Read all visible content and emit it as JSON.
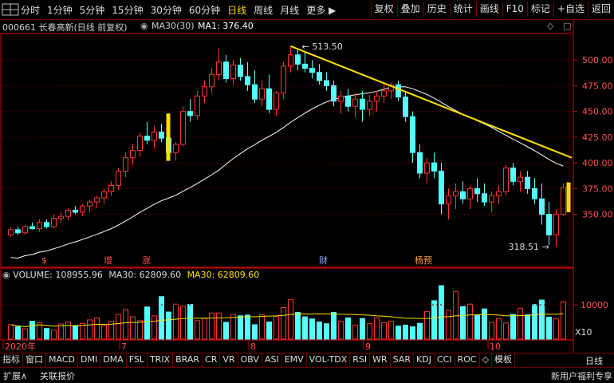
{
  "toolbar": {
    "periods": [
      "分时",
      "1分钟",
      "5分钟",
      "15分钟",
      "30分钟",
      "60分钟",
      "日线",
      "周线",
      "月线",
      "更多"
    ],
    "active_period": "日线",
    "more_arrow": "▶",
    "buttons": [
      "复权",
      "叠加",
      "历史",
      "统计",
      "画线",
      "F10",
      "标记",
      "+自选",
      "返回"
    ]
  },
  "info": {
    "stock": "000661 长春高新(日线 前复权)",
    "ma30_label": "MA30(30)",
    "ma1_label": "MA1: 376.40"
  },
  "volume_info": {
    "volume": "VOLUME: 108955.96",
    "ma30_white": "MA30: 62809.60",
    "ma30_yellow": "MA30: 62809.60",
    "multiplier": "X10"
  },
  "annotations": {
    "high": "513.50",
    "low": "318.51",
    "markers": [
      "$",
      "增",
      "涨",
      "财",
      "杨预"
    ]
  },
  "tabs": [
    "指标",
    "窗口",
    "MACD",
    "DMI",
    "DMA",
    "FSL",
    "TRIX",
    "BRAR",
    "CR",
    "VR",
    "OBV",
    "ASI",
    "EMV",
    "VOL-TDX",
    "RSI",
    "WR",
    "SAR",
    "KDJ",
    "CCI",
    "ROC",
    "◇",
    "模板"
  ],
  "tab_right": "日线",
  "bottom": {
    "expand": "扩展∧",
    "related": "关联报价",
    "promo": "新用户福利专享"
  },
  "colors": {
    "up": "#ff3232",
    "down": "#54ffff",
    "trend": "#ffe000",
    "ma": "#ffffff",
    "axis": "#d00000"
  },
  "chart_data": {
    "type": "candlestick",
    "y_ticks": [
      500.0,
      475.0,
      450.0,
      425.0,
      400.0,
      375.0,
      350.0
    ],
    "volume_ticks": [
      10000
    ],
    "x_labels": [
      "2020年",
      "7",
      "8",
      "9",
      "10"
    ],
    "ylim": [
      300,
      525
    ],
    "series": [
      {
        "name": "MA30",
        "values": []
      }
    ],
    "candles": [
      [
        330,
        337,
        328,
        335
      ],
      [
        335,
        338,
        330,
        332
      ],
      [
        332,
        340,
        330,
        338
      ],
      [
        338,
        342,
        335,
        336
      ],
      [
        336,
        345,
        333,
        342
      ],
      [
        342,
        345,
        336,
        338
      ],
      [
        338,
        350,
        336,
        346
      ],
      [
        346,
        352,
        342,
        348
      ],
      [
        348,
        356,
        344,
        354
      ],
      [
        354,
        358,
        350,
        352
      ],
      [
        352,
        360,
        348,
        358
      ],
      [
        358,
        364,
        352,
        362
      ],
      [
        362,
        368,
        356,
        366
      ],
      [
        366,
        375,
        360,
        372
      ],
      [
        372,
        382,
        368,
        378
      ],
      [
        378,
        395,
        374,
        392
      ],
      [
        392,
        410,
        386,
        405
      ],
      [
        405,
        418,
        398,
        412
      ],
      [
        412,
        430,
        406,
        426
      ],
      [
        426,
        440,
        418,
        422
      ],
      [
        422,
        436,
        414,
        430
      ],
      [
        430,
        438,
        420,
        424
      ],
      [
        424,
        432,
        405,
        410
      ],
      [
        410,
        420,
        402,
        418
      ],
      [
        418,
        455,
        416,
        450
      ],
      [
        450,
        462,
        440,
        446
      ],
      [
        446,
        470,
        442,
        465
      ],
      [
        465,
        480,
        458,
        474
      ],
      [
        474,
        492,
        468,
        486
      ],
      [
        486,
        512,
        480,
        498
      ],
      [
        498,
        505,
        478,
        482
      ],
      [
        482,
        500,
        476,
        495
      ],
      [
        495,
        502,
        480,
        484
      ],
      [
        484,
        498,
        470,
        476
      ],
      [
        476,
        490,
        458,
        462
      ],
      [
        462,
        480,
        455,
        472
      ],
      [
        472,
        486,
        448,
        452
      ],
      [
        452,
        470,
        446,
        468
      ],
      [
        468,
        498,
        462,
        494
      ],
      [
        494,
        513.5,
        488,
        505
      ],
      [
        505,
        510,
        490,
        496
      ],
      [
        496,
        508,
        488,
        492
      ],
      [
        492,
        500,
        482,
        488
      ],
      [
        488,
        496,
        476,
        480
      ],
      [
        480,
        488,
        470,
        475
      ],
      [
        475,
        480,
        455,
        460
      ],
      [
        460,
        470,
        448,
        465
      ],
      [
        465,
        472,
        450,
        455
      ],
      [
        455,
        468,
        444,
        462
      ],
      [
        462,
        470,
        440,
        452
      ],
      [
        452,
        466,
        446,
        460
      ],
      [
        460,
        470,
        450,
        465
      ],
      [
        465,
        478,
        458,
        470
      ],
      [
        470,
        478,
        462,
        476
      ],
      [
        476,
        480,
        460,
        464
      ],
      [
        464,
        470,
        440,
        445
      ],
      [
        445,
        450,
        400,
        410
      ],
      [
        410,
        418,
        385,
        390
      ],
      [
        390,
        405,
        380,
        400
      ],
      [
        400,
        410,
        385,
        392
      ],
      [
        392,
        400,
        350,
        360
      ],
      [
        360,
        375,
        345,
        368
      ],
      [
        368,
        380,
        355,
        372
      ],
      [
        372,
        382,
        360,
        365
      ],
      [
        365,
        378,
        355,
        375
      ],
      [
        375,
        385,
        362,
        370
      ],
      [
        370,
        380,
        358,
        362
      ],
      [
        362,
        372,
        352,
        368
      ],
      [
        368,
        378,
        360,
        372
      ],
      [
        372,
        398,
        368,
        395
      ],
      [
        395,
        400,
        378,
        382
      ],
      [
        382,
        392,
        372,
        386
      ],
      [
        386,
        392,
        370,
        375
      ],
      [
        375,
        385,
        360,
        365
      ],
      [
        365,
        380,
        340,
        350
      ],
      [
        350,
        362,
        320,
        330
      ],
      [
        330,
        355,
        318.51,
        350
      ],
      [
        350,
        380,
        348,
        376
      ]
    ],
    "volumes": [
      4200,
      3600,
      3000,
      5200,
      4800,
      3100,
      2600,
      4400,
      5000,
      3800,
      4600,
      5600,
      6200,
      4000,
      5200,
      7200,
      8600,
      6500,
      5400,
      9400,
      6800,
      12400,
      7900,
      10200,
      9600,
      10100,
      5400,
      6000,
      7600,
      7600,
      4900,
      7200,
      6800,
      7000,
      4200,
      7100,
      5000,
      6600,
      9200,
      11500,
      7800,
      6500,
      5900,
      5000,
      4500,
      7800,
      5200,
      6200,
      4100,
      6000,
      4500,
      6200,
      4800,
      5200,
      3800,
      4100,
      3600,
      4600,
      8000,
      11200,
      15600,
      8400,
      13900,
      9500,
      10200,
      7000,
      8800,
      4900,
      6000,
      4700,
      7200,
      9000,
      7100,
      10100,
      11400,
      6400,
      5900,
      10900
    ]
  }
}
